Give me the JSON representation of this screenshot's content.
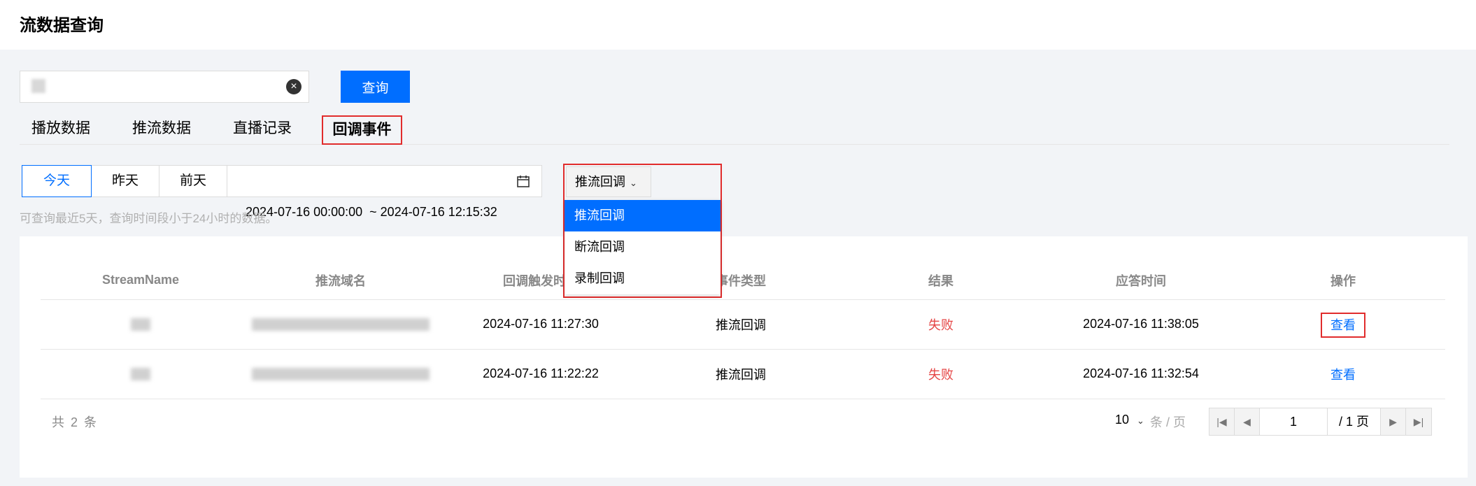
{
  "page": {
    "title": "流数据查询"
  },
  "search": {
    "value": "i",
    "clear_icon": "close-circle-icon",
    "query_label": "查询"
  },
  "tabs": [
    {
      "label": "播放数据",
      "active": false
    },
    {
      "label": "推流数据",
      "active": false
    },
    {
      "label": "直播记录",
      "active": false
    },
    {
      "label": "回调事件",
      "active": true
    }
  ],
  "date_filter": {
    "quick": [
      "今天",
      "昨天",
      "前天"
    ],
    "selected": "今天",
    "range": "2024-07-16 00:00:00  ~ 2024-07-16 12:15:32",
    "icon": "calendar-icon",
    "hint": "可查询最近5天，查询时间段小于24小时的数据。"
  },
  "event_type_select": {
    "selected": "推流回调",
    "options": [
      "推流回调",
      "断流回调",
      "录制回调"
    ]
  },
  "table": {
    "columns": [
      "StreamName",
      "推流域名",
      "回调触发时间",
      "事件类型",
      "结果",
      "应答时间",
      "操作"
    ],
    "rows": [
      {
        "stream_name": "xx",
        "domain": "xxxxxxxxxxxxxxxxxxxxxxxxxxxx",
        "trigger_time": "2024-07-16 11:27:30",
        "event_type": "推流回调",
        "result": "失败",
        "response_time": "2024-07-16 11:38:05",
        "action": "查看"
      },
      {
        "stream_name": "xx",
        "domain": "xxxxxxxxxxxxxxxxxxxxxxxxxxxx",
        "trigger_time": "2024-07-16 11:22:22",
        "event_type": "推流回调",
        "result": "失败",
        "response_time": "2024-07-16 11:32:54",
        "action": "查看"
      }
    ]
  },
  "pagination": {
    "total_text": "共 2 条",
    "page_size": "10",
    "page_size_suffix": "条 / 页",
    "current_page": "1",
    "total_pages": "/ 1 页"
  },
  "colors": {
    "primary": "#006eff",
    "highlight_border": "#e12c2c",
    "fail": "#e54545"
  }
}
